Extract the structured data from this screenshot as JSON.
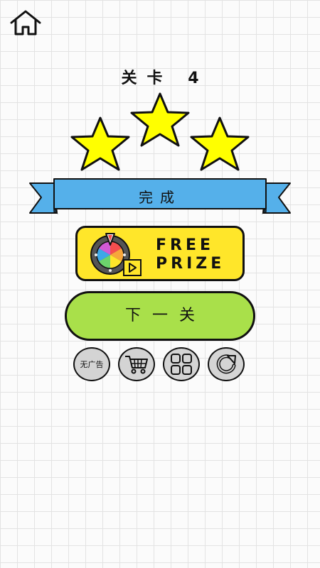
{
  "level": {
    "label": "关卡",
    "number": "4",
    "stars_earned": 3,
    "stars_total": 3
  },
  "banner": {
    "text": "完成"
  },
  "free_prize": {
    "line1": "FREE",
    "line2": "PRIZE",
    "icon": "prize-wheel-icon"
  },
  "next_level": {
    "label": "下一关"
  },
  "bottom_buttons": {
    "no_ads": "无广告",
    "shop_icon": "cart-icon",
    "levels_icon": "grid-icon",
    "restart_icon": "restart-icon"
  },
  "colors": {
    "star": "#ffff00",
    "banner": "#55b0ea",
    "prize_button": "#ffe62a",
    "next_button": "#a9e04a",
    "round_button": "#d4d4d4"
  }
}
